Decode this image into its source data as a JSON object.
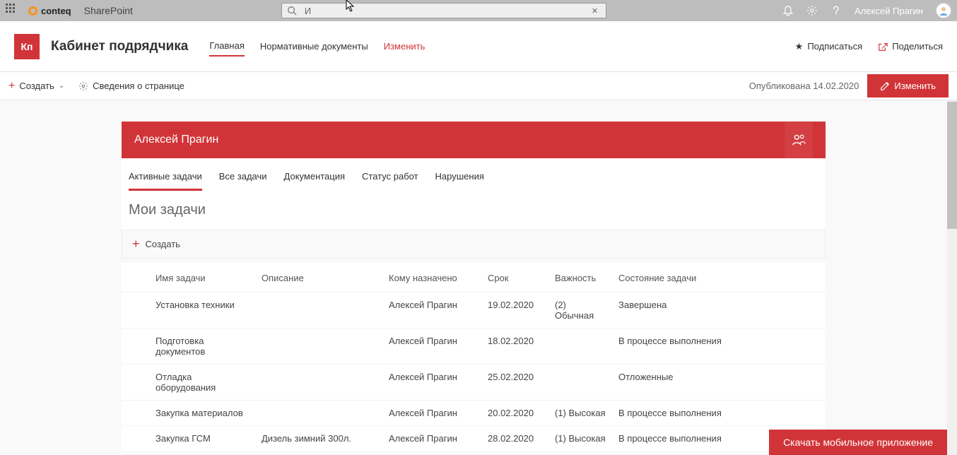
{
  "suite": {
    "brand": "conteq",
    "app": "SharePoint",
    "search_value": "И",
    "user_name": "Алексей Прагин"
  },
  "site": {
    "logo_text": "Кп",
    "title": "Кабинет подрядчика",
    "nav": [
      {
        "label": "Главная",
        "active": true
      },
      {
        "label": "Нормативные документы",
        "active": false
      },
      {
        "label": "Изменить",
        "edit": true
      }
    ],
    "follow": "Подписаться",
    "share": "Поделиться"
  },
  "cmd": {
    "create": "Создать",
    "page_details": "Сведения о странице",
    "published": "Опубликована 14.02.2020",
    "edit": "Изменить"
  },
  "banner": {
    "user": "Алексей Прагин"
  },
  "inner_tabs": [
    {
      "label": "Активные задачи",
      "active": true
    },
    {
      "label": "Все задачи"
    },
    {
      "label": "Документация"
    },
    {
      "label": "Статус работ"
    },
    {
      "label": "Нарушения"
    }
  ],
  "section": {
    "title": "Мои задачи",
    "create": "Создать"
  },
  "table": {
    "headers": {
      "name": "Имя задачи",
      "desc": "Описание",
      "assign": "Кому назначено",
      "due": "Срок",
      "prio": "Важность",
      "state": "Состояние задачи"
    },
    "rows": [
      {
        "name": "Установка техники",
        "desc": "",
        "assign": "Алексей Прагин",
        "due": "19.02.2020",
        "prio": "(2) Обычная",
        "state": "Завершена"
      },
      {
        "name": "Подготовка документов",
        "desc": "",
        "assign": "Алексей Прагин",
        "due": "18.02.2020",
        "prio": "",
        "state": "В процессе выполнения"
      },
      {
        "name": "Отладка оборудования",
        "desc": "",
        "assign": "Алексей Прагин",
        "due": "25.02.2020",
        "prio": "",
        "state": "Отложенные"
      },
      {
        "name": "Закупка материалов",
        "desc": "",
        "assign": "Алексей Прагин",
        "due": "20.02.2020",
        "prio": "(1) Высокая",
        "state": "В процессе выполнения"
      },
      {
        "name": "Закупка ГСМ",
        "desc": "Дизель зимний 300л.",
        "assign": "Алексей Прагин",
        "due": "28.02.2020",
        "prio": "(1) Высокая",
        "state": "В процессе выполнения"
      }
    ]
  },
  "mobile_btn": "Скачать мобильное приложение"
}
